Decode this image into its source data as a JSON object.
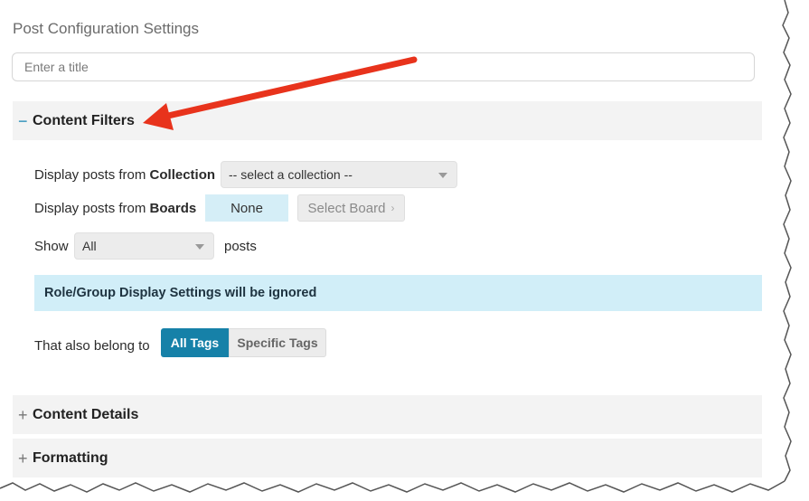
{
  "page": {
    "title": "Post Configuration Settings"
  },
  "title_input": {
    "placeholder": "Enter a title",
    "value": ""
  },
  "sections": [
    {
      "toggle": "−",
      "title": "Content Filters",
      "expanded": true
    },
    {
      "toggle": "+",
      "title": "Content Details",
      "expanded": false
    },
    {
      "toggle": "+",
      "title": "Formatting",
      "expanded": false
    }
  ],
  "filters": {
    "collection": {
      "label_prefix": "Display posts from ",
      "label_bold": "Collection",
      "selected": "-- select a collection --"
    },
    "boards": {
      "label_prefix": "Display posts from ",
      "label_bold": "Boards",
      "none_button": "None",
      "select_button": "Select Board",
      "select_chevron": "›"
    },
    "show": {
      "label": "Show",
      "selected": "All",
      "suffix": "posts"
    },
    "notice": "Role/Group Display Settings will be ignored",
    "tags": {
      "label": "That also belong to",
      "all_button": "All Tags",
      "specific_button": "Specific Tags",
      "active": "All Tags"
    }
  },
  "colors": {
    "accent": "#1681a8",
    "notice_bg": "#d1eef8",
    "section_bg": "#f3f3f3",
    "annotation_arrow": "#e8331c"
  },
  "icons": {
    "collapse": "minus-icon",
    "expand": "plus-icon",
    "dropdown": "caret-down-icon",
    "select_board": "chevron-right-icon",
    "annotation": "red-arrow"
  }
}
